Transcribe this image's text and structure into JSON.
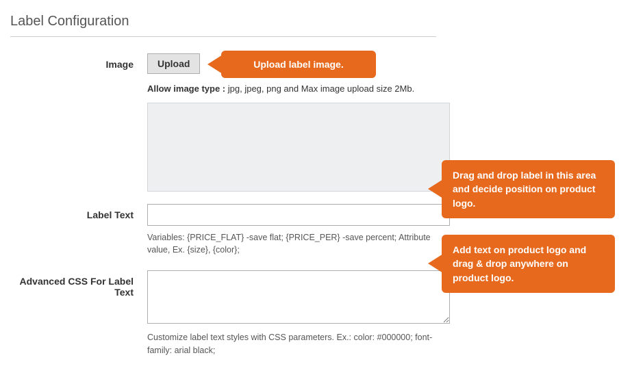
{
  "section_title": "Label Configuration",
  "image": {
    "label": "Image",
    "upload_label": "Upload",
    "hint_prefix": "Allow image type : ",
    "hint_value": "jpg, jpeg, png and Max image upload size 2Mb."
  },
  "label_text": {
    "label": "Label Text",
    "value": "",
    "hint": "Variables: {PRICE_FLAT} -save flat; {PRICE_PER} -save percent; Attribute value, Ex. {size}, {color};"
  },
  "advanced_css": {
    "label": "Advanced CSS For Label Text",
    "value": "",
    "hint": "Customize label text styles with CSS parameters. Ex.: color: #000000; font-family: arial black;"
  },
  "callouts": {
    "upload": "Upload label image.",
    "drop": "Drag and drop label in this area and decide position on product logo.",
    "text": "Add text on product logo and drag & drop anywhere on product logo."
  }
}
